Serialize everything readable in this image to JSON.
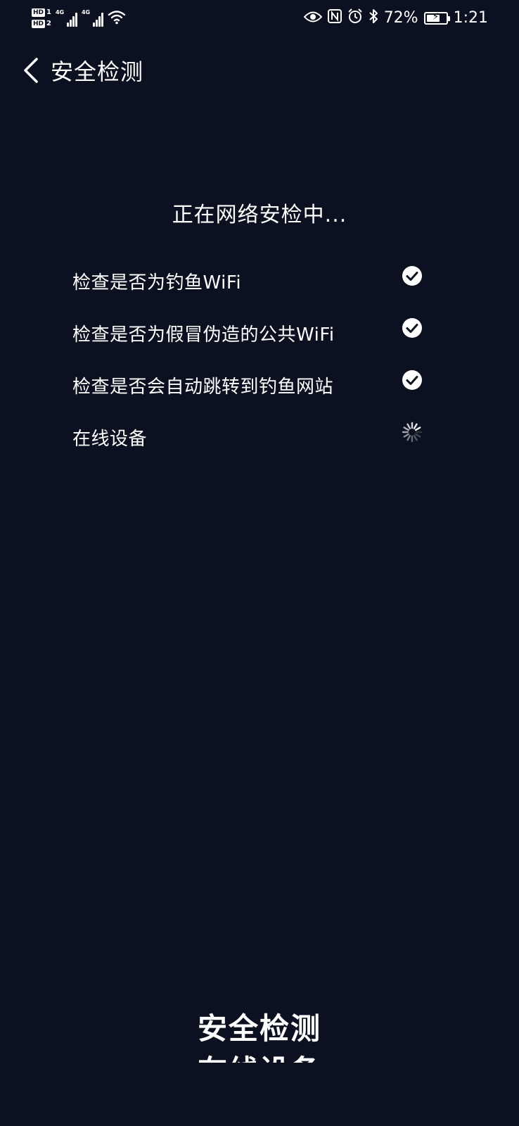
{
  "status_bar": {
    "sim1_label": "HD",
    "sim1_index": "1",
    "sim2_label": "HD",
    "sim2_index": "2",
    "sim1_network": "4G",
    "sim2_network": "4G",
    "battery_percent": "72%",
    "battery_level": 0.72,
    "time": "1:21",
    "icons": [
      "eye-icon",
      "nfc-icon",
      "alarm-icon",
      "bluetooth-icon",
      "wifi-icon",
      "battery-charging-icon"
    ]
  },
  "header": {
    "title": "安全检测",
    "back_icon": "chevron-left-icon"
  },
  "main": {
    "scan_status": "正在网络安检中...",
    "checks": [
      {
        "label": "检查是否为钓鱼WiFi",
        "state": "done"
      },
      {
        "label": "检查是否为假冒伪造的公共WiFi",
        "state": "done"
      },
      {
        "label": "检查是否会自动跳转到钓鱼网站",
        "state": "done"
      },
      {
        "label": "在线设备",
        "state": "loading"
      }
    ]
  },
  "bottom_overlay": {
    "line1": "安全检测",
    "line2": "在线设备"
  },
  "colors": {
    "background": "#0b1120",
    "text": "#ffffff",
    "check_fill": "#ffffff",
    "check_mark": "#0b1120"
  }
}
